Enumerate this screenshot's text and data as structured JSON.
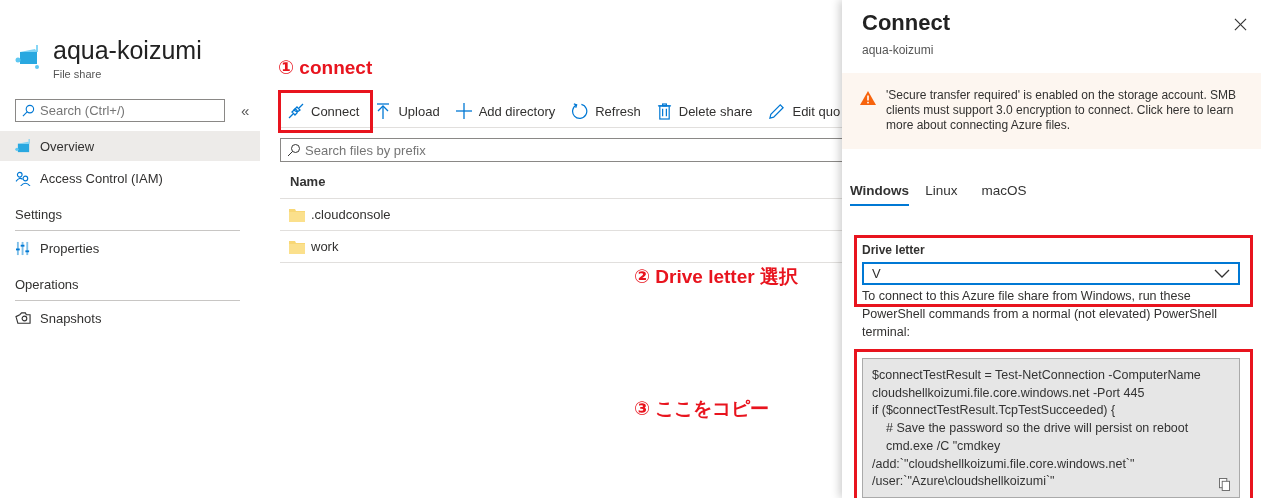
{
  "resource": {
    "title": "aqua-koizumi",
    "subtitle": "File share"
  },
  "sidebar": {
    "search": {
      "placeholder": "Search (Ctrl+/)"
    },
    "collapse": "«",
    "sections": [
      {
        "items": [
          {
            "label": "Overview",
            "selected": true
          },
          {
            "label": "Access Control (IAM)",
            "selected": false
          }
        ]
      },
      {
        "heading": "Settings",
        "items": [
          {
            "label": "Properties",
            "selected": false
          }
        ]
      },
      {
        "heading": "Operations",
        "items": [
          {
            "label": "Snapshots",
            "selected": false
          }
        ]
      }
    ]
  },
  "toolbar": [
    {
      "label": "Connect"
    },
    {
      "label": "Upload"
    },
    {
      "label": "Add directory"
    },
    {
      "label": "Refresh"
    },
    {
      "label": "Delete share"
    },
    {
      "label": "Edit quo"
    }
  ],
  "file_search": {
    "placeholder": "Search files by prefix"
  },
  "table": {
    "columns": [
      "Name"
    ],
    "rows": [
      {
        "name": ".cloudconsole"
      },
      {
        "name": "work"
      }
    ]
  },
  "panel": {
    "title": "Connect",
    "subtitle": "aqua-koizumi",
    "warning": "'Secure transfer required' is enabled on the storage account. SMB clients must support 3.0 encryption to connect. Click here to learn more about connecting Azure files.",
    "tabs": [
      {
        "label": "Windows",
        "selected": true
      },
      {
        "label": "Linux",
        "selected": false
      },
      {
        "label": "macOS",
        "selected": false
      }
    ],
    "drive_letter": {
      "label": "Drive letter",
      "value": "V"
    },
    "instructions": "To connect to this Azure file share from Windows, run these PowerShell commands from a normal (not elevated) PowerShell terminal:",
    "code": [
      {
        "text": "$connectTestResult = Test-NetConnection -ComputerName",
        "indented": false
      },
      {
        "text": "cloudshellkoizumi.file.core.windows.net -Port 445",
        "indented": false
      },
      {
        "text": "if ($connectTestResult.TcpTestSucceeded) {",
        "indented": false
      },
      {
        "text": "# Save the password so the drive will persist on reboot",
        "indented": true
      },
      {
        "text": "cmd.exe /C \"cmdkey",
        "indented": true
      },
      {
        "text": "/add:`\"cloudshellkoizumi.file.core.windows.net`\"",
        "indented": false
      },
      {
        "text": "/user:`\"Azure\\cloudshellkoizumi`\"",
        "indented": false
      }
    ]
  },
  "annotations": [
    {
      "text": "① connect"
    },
    {
      "text": "② Drive letter 選択"
    },
    {
      "text": "③ ここをコピー"
    }
  ]
}
